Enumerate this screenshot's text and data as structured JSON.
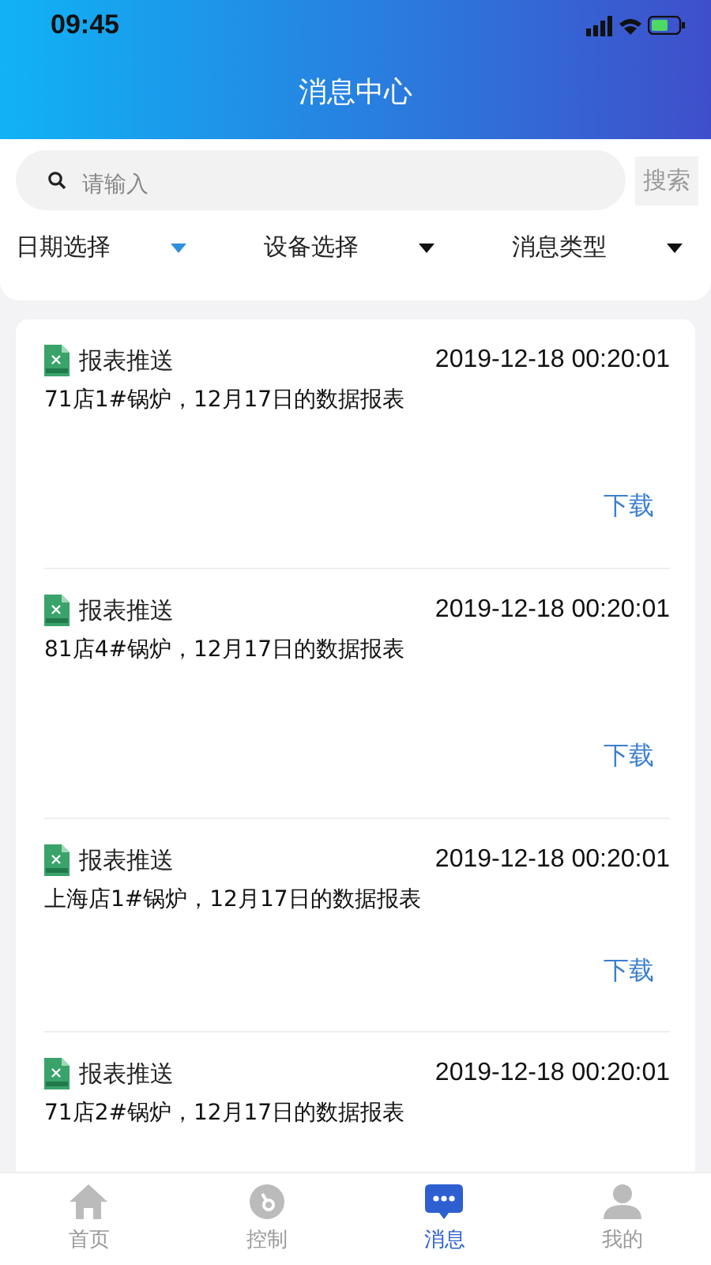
{
  "status_bar": {
    "time": "09:45"
  },
  "header": {
    "title": "消息中心"
  },
  "search": {
    "placeholder": "请输入",
    "button": "搜索"
  },
  "filters": [
    {
      "label": "日期选择",
      "selected": true
    },
    {
      "label": "设备选择",
      "selected": false
    },
    {
      "label": "消息类型",
      "selected": false
    }
  ],
  "messages": [
    {
      "type": "报表推送",
      "time": "2019-12-18 00:20:01",
      "text": "71店1#锅炉，12月17日的数据报表",
      "action": "下载"
    },
    {
      "type": "报表推送",
      "time": "2019-12-18 00:20:01",
      "text": "81店4#锅炉，12月17日的数据报表",
      "action": "下载"
    },
    {
      "type": "报表推送",
      "time": "2019-12-18 00:20:01",
      "text": "上海店1#锅炉，12月17日的数据报表",
      "action": "下载"
    },
    {
      "type": "报表推送",
      "time": "2019-12-18 00:20:01",
      "text": "71店2#锅炉，12月17日的数据报表"
    }
  ],
  "tab_bar": [
    {
      "kind": "home",
      "label": "首页",
      "selected": false
    },
    {
      "kind": "control",
      "label": "控制",
      "selected": false
    },
    {
      "kind": "message",
      "label": "消息",
      "selected": true
    },
    {
      "kind": "user",
      "label": "我的",
      "selected": false
    }
  ]
}
